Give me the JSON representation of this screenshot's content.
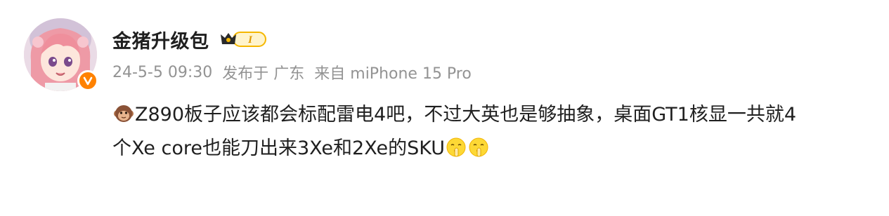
{
  "post": {
    "author": {
      "name": "金猪升级包",
      "level_badge_text": "I",
      "avatar_icon": "anime-girl-avatar",
      "verified_icon": "orange-v-verified-icon"
    },
    "meta": {
      "timestamp": "24-5-5 09:30",
      "location": "发布于 广东",
      "source": "来自 miPhone 15 Pro"
    },
    "content": {
      "leading_emoji": "monkey-face-emoji",
      "line1": "Z890板子应该都会标配雷电4吧，不过大英也是够抽象，桌面GT1核显一共就4",
      "line2": "个Xe core也能刀出来3Xe和2Xe的SKU",
      "trailing_emojis": [
        "shushing-face-emoji",
        "shushing-face-emoji"
      ]
    }
  },
  "colors": {
    "verified_orange": "#ff8200",
    "meta_gray": "#939393",
    "text": "#1f1f1f",
    "level_gold": "#f5b700"
  }
}
